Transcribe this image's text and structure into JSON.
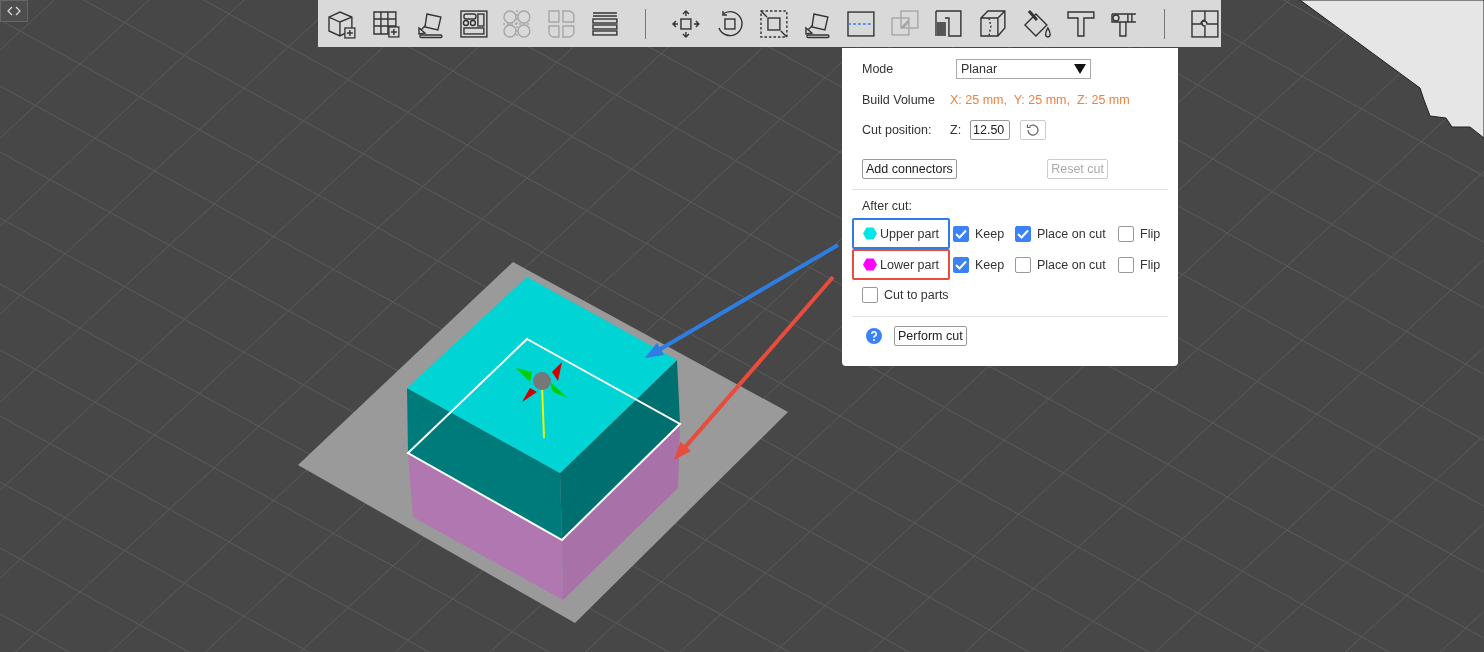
{
  "toolbar": {
    "groups": [
      [
        {
          "disabled": false
        },
        {
          "disabled": false
        },
        {
          "disabled": false
        },
        {
          "disabled": false
        },
        {
          "disabled": true
        },
        {
          "disabled": true
        },
        {
          "disabled": false
        }
      ],
      [
        {
          "disabled": false
        },
        {
          "disabled": false
        },
        {
          "disabled": false
        },
        {
          "disabled": false
        },
        {
          "disabled": false
        },
        {
          "disabled": true
        },
        {
          "disabled": false
        },
        {
          "disabled": false
        },
        {
          "disabled": false
        },
        {
          "disabled": false
        },
        {
          "disabled": false
        }
      ],
      [
        {
          "disabled": false
        }
      ]
    ]
  },
  "cut_panel": {
    "mode": {
      "label": "Mode",
      "value": "Planar"
    },
    "build_volume": {
      "label": "Build Volume",
      "value": "X: 25 mm,  Y: 25 mm,  Z: 25 mm"
    },
    "cut_position": {
      "label": "Cut position:",
      "axis": "Z:",
      "value": "12.50"
    },
    "buttons": [
      {
        "label": "Add connectors",
        "disabled": false
      },
      {
        "label": "Reset cut",
        "disabled": true
      }
    ],
    "after_cut": {
      "label": "After cut:",
      "parts": [
        {
          "label": "Upper part",
          "color": "#00e5e5",
          "highlight": {
            "color": "#2f7de1"
          },
          "options": [
            {
              "label": "Keep",
              "checked": true
            },
            {
              "label": "Place on cut",
              "checked": true
            },
            {
              "label": "Flip",
              "checked": false
            }
          ]
        },
        {
          "label": "Lower part",
          "color": "#ff00ff",
          "highlight": {
            "color": "#e84c3d"
          },
          "options": [
            {
              "label": "Keep",
              "checked": true
            },
            {
              "label": "Place on cut",
              "checked": false
            },
            {
              "label": "Flip",
              "checked": false
            }
          ]
        }
      ],
      "cut_to_parts": {
        "label": "Cut to parts",
        "checked": false
      }
    },
    "perform_button": {
      "label": "Perform cut"
    }
  },
  "annotations": [
    {
      "color": "#2f7de1"
    },
    {
      "color": "#e84c3d"
    }
  ]
}
